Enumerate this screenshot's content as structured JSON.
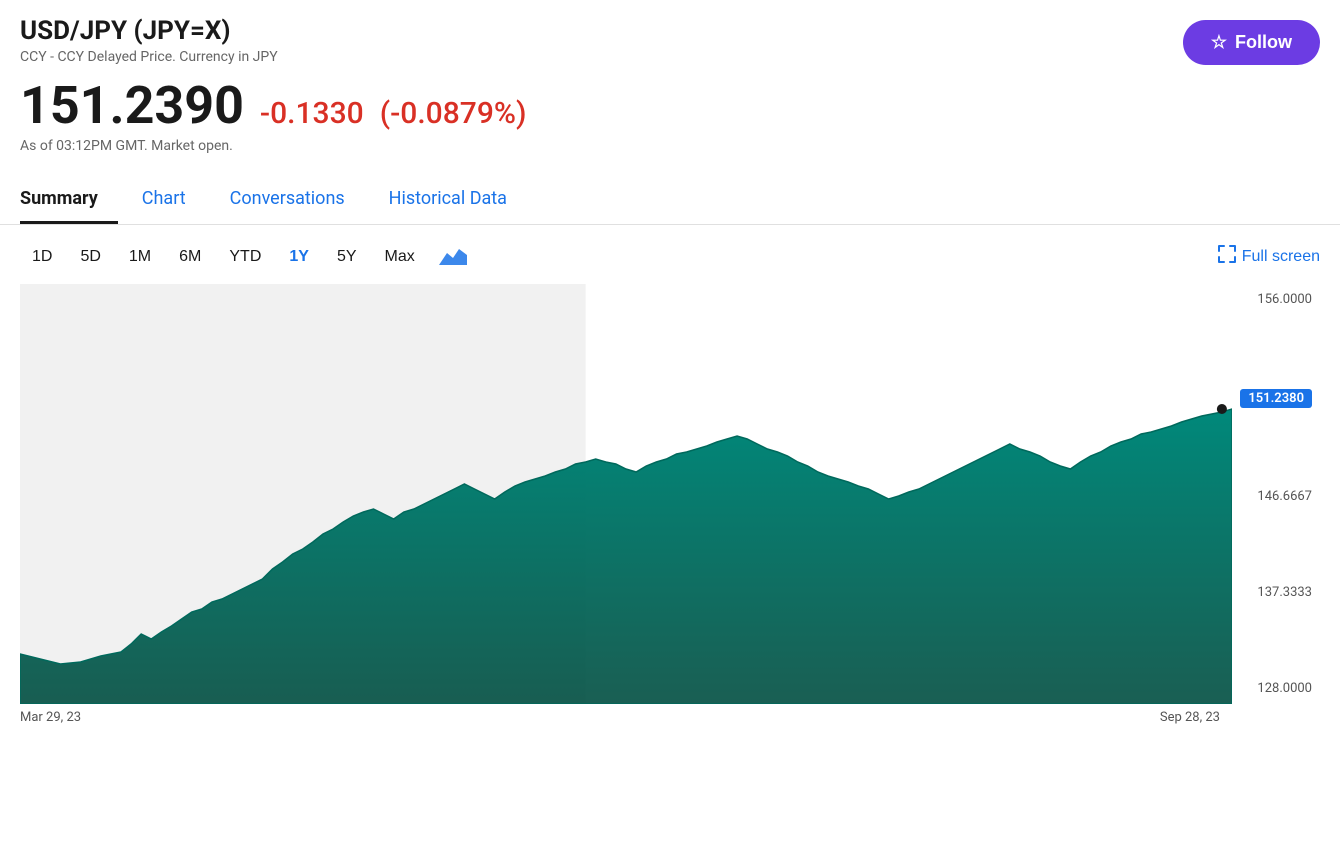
{
  "header": {
    "ticker_symbol": "USD/JPY (JPY=X)",
    "subtitle": "CCY - CCY Delayed Price. Currency in JPY",
    "follow_label": "Follow"
  },
  "price": {
    "current": "151.2390",
    "change": "-0.1330",
    "change_pct": "(-0.0879%)",
    "timestamp": "As of 03:12PM GMT. Market open.",
    "current_chart": "151.2380"
  },
  "tabs": [
    {
      "id": "summary",
      "label": "Summary",
      "active": true
    },
    {
      "id": "chart",
      "label": "Chart",
      "active": false
    },
    {
      "id": "conversations",
      "label": "Conversations",
      "active": false
    },
    {
      "id": "historical",
      "label": "Historical Data",
      "active": false
    }
  ],
  "chart_controls": {
    "time_periods": [
      {
        "label": "1D",
        "active": false
      },
      {
        "label": "5D",
        "active": false
      },
      {
        "label": "1M",
        "active": false
      },
      {
        "label": "6M",
        "active": false
      },
      {
        "label": "YTD",
        "active": false
      },
      {
        "label": "1Y",
        "active": true
      },
      {
        "label": "5Y",
        "active": false
      },
      {
        "label": "Max",
        "active": false
      }
    ],
    "fullscreen_label": "Full screen"
  },
  "chart": {
    "y_axis": {
      "top": "156.0000",
      "mid_high": "146.6667",
      "mid": "137.3333",
      "bottom": "128.0000",
      "current_price": "151.2380"
    },
    "x_axis": {
      "left_label": "Mar 29, 23",
      "right_label": "Sep 28, 23"
    },
    "colors": {
      "area_fill": "#00897b",
      "area_fill_light": "#26a69a",
      "shaded_region": "#e8e8e8"
    }
  }
}
